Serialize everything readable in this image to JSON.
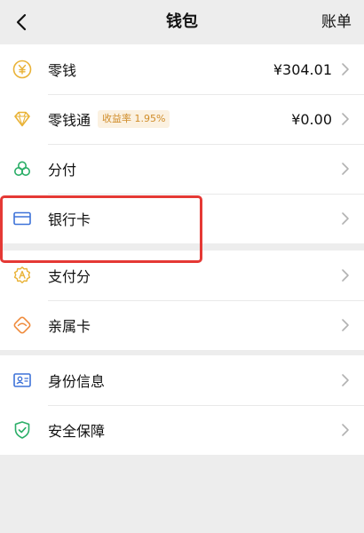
{
  "header": {
    "title": "钱包",
    "right_label": "账单"
  },
  "groups": [
    {
      "items": [
        {
          "label": "零钱",
          "value": "¥304.01",
          "icon": "yuan-coin-icon"
        },
        {
          "label": "零钱通",
          "badge": "收益率 1.95%",
          "value": "¥0.00",
          "icon": "diamond-icon"
        },
        {
          "label": "分付",
          "icon": "clover-icon"
        },
        {
          "label": "银行卡",
          "icon": "bank-card-icon"
        }
      ]
    },
    {
      "items": [
        {
          "label": "支付分",
          "icon": "score-badge-icon"
        },
        {
          "label": "亲属卡",
          "icon": "family-card-icon"
        }
      ]
    },
    {
      "items": [
        {
          "label": "身份信息",
          "icon": "id-card-icon"
        },
        {
          "label": "安全保障",
          "icon": "shield-check-icon"
        }
      ]
    }
  ],
  "colors": {
    "accent_gold": "#e9b236",
    "accent_green": "#2aae67",
    "accent_blue": "#3d72d8",
    "highlight_red": "#e53935",
    "badge_text": "#d08d2a"
  }
}
